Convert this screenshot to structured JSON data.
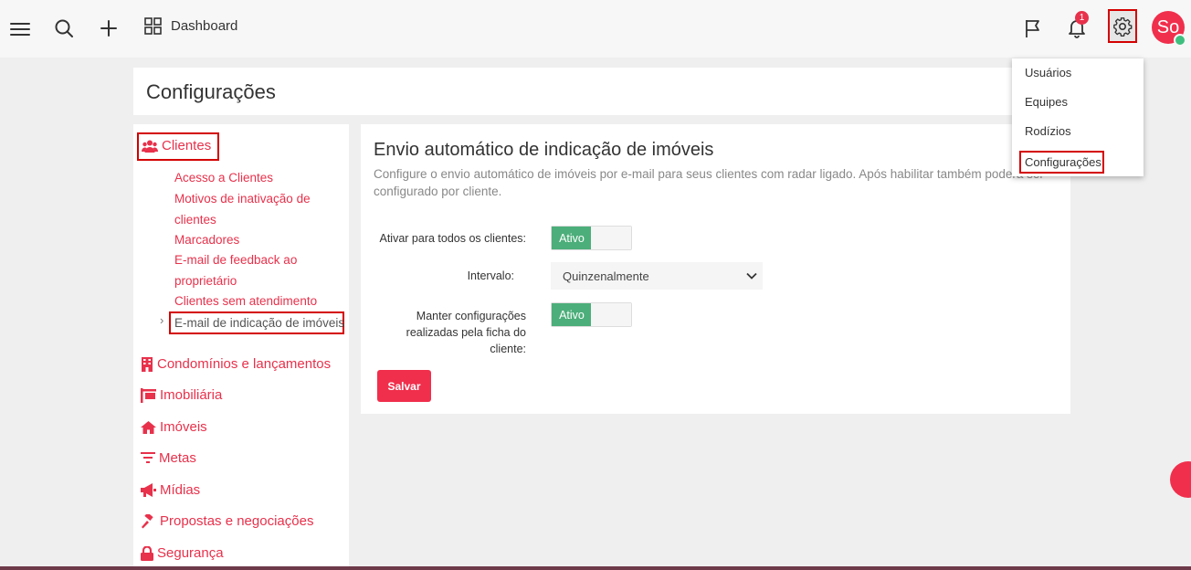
{
  "topbar": {
    "dashboard_label": "Dashboard",
    "notification_count": "1",
    "avatar_initials": "So"
  },
  "page": {
    "title": "Configurações"
  },
  "sidebar": {
    "clientes": {
      "label": "Clientes",
      "items": [
        "Acesso a Clientes",
        "Motivos de inativação de clientes",
        "Marcadores",
        "E-mail de feedback ao proprietário",
        "Clientes sem atendimento",
        "E-mail de indicação de imóveis"
      ]
    },
    "condominios": "Condomínios e lançamentos",
    "imobiliaria": "Imobiliária",
    "imoveis": "Imóveis",
    "metas": "Metas",
    "midias": "Mídias",
    "propostas": "Propostas e negociações",
    "seguranca": "Segurança"
  },
  "main": {
    "title": "Envio automático de indicação de imóveis",
    "description": "Configure o envio automático de imóveis por e-mail para seus clientes com radar ligado. Após habilitar também poderá ser configurado por cliente.",
    "ativar_label": "Ativar para todos os clientes:",
    "ativar_state": "Ativo",
    "intervalo_label": "Intervalo:",
    "intervalo_value": "Quinzenalmente",
    "manter_label": "Manter configurações realizadas pela ficha do cliente:",
    "manter_state": "Ativo",
    "save_label": "Salvar"
  },
  "settings_menu": {
    "items": [
      "Usuários",
      "Equipes",
      "Rodízios",
      "Configurações"
    ]
  },
  "colors": {
    "accent": "#f02f4c",
    "toggle_on": "#4cae7a",
    "highlight": "#d40000"
  }
}
